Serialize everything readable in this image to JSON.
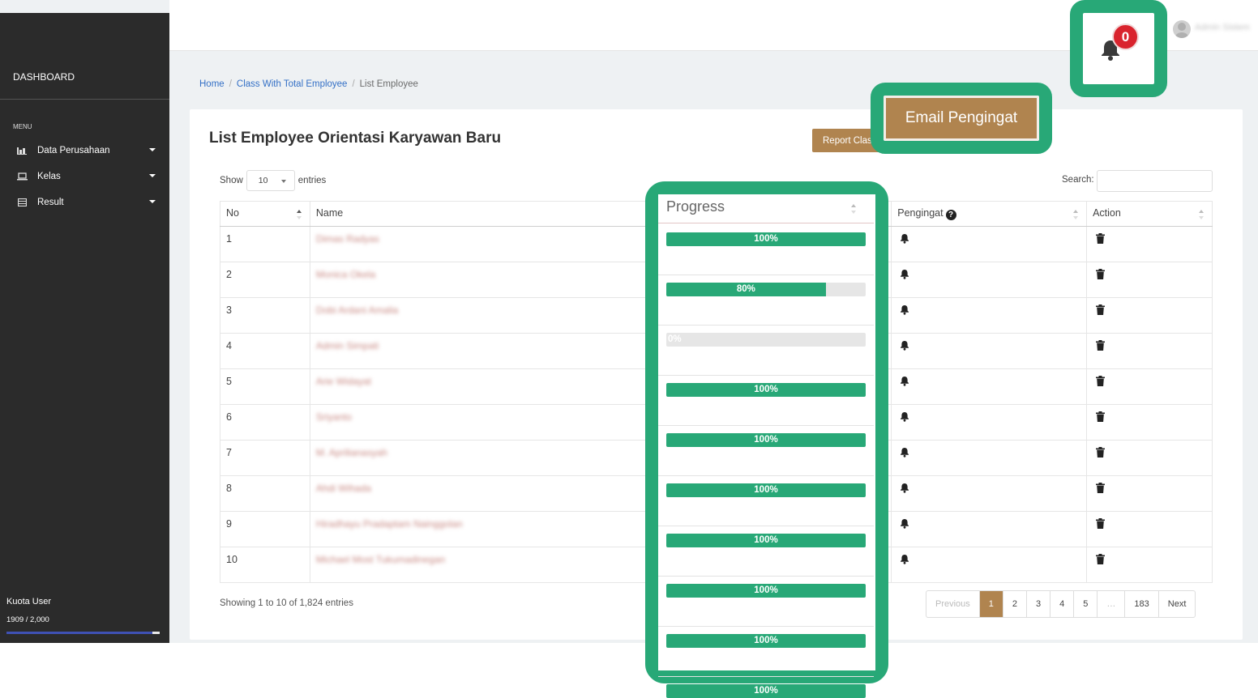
{
  "sidebar": {
    "brand": "DASHBOARD",
    "menu_label": "MENU",
    "items": [
      {
        "label": "Data Perusahaan",
        "icon": "bar-chart-icon"
      },
      {
        "label": "Kelas",
        "icon": "laptop-icon"
      },
      {
        "label": "Result",
        "icon": "table-icon"
      }
    ],
    "kuota": {
      "label": "Kuota User",
      "value": "1909 / 2,000",
      "fraction": 0.9545
    }
  },
  "topbar": {
    "notification_count": "0",
    "user_name": "Admin Sistem"
  },
  "breadcrumb": {
    "home": "Home",
    "class": "Class With Total Employee",
    "current": "List Employee"
  },
  "page": {
    "title": "List Employee Orientasi Karyawan Baru",
    "report_button": "Report Class",
    "email_button": "Email Pengingat",
    "show_label": "Show",
    "entries_value": "10",
    "entries_label": "entries",
    "search_label": "Search:",
    "search_value": ""
  },
  "table": {
    "headers": {
      "no": "No",
      "name": "Name",
      "progress": "Progress",
      "pengingat": "Pengingat",
      "action": "Action"
    },
    "rows": [
      {
        "no": "1",
        "name": "Dimas Radyas",
        "progress": 100,
        "progress_label": "100%"
      },
      {
        "no": "2",
        "name": "Monica Okela",
        "progress": 80,
        "progress_label": "80%"
      },
      {
        "no": "3",
        "name": "Dobi Ardani Amalia",
        "progress": 0,
        "progress_label": "0%"
      },
      {
        "no": "4",
        "name": "Admin Simpati",
        "progress": 100,
        "progress_label": "100%"
      },
      {
        "no": "5",
        "name": "Arie Widayat",
        "progress": 100,
        "progress_label": "100%"
      },
      {
        "no": "6",
        "name": "Sriyanto",
        "progress": 100,
        "progress_label": "100%"
      },
      {
        "no": "7",
        "name": "M. Aprilianasyah",
        "progress": 100,
        "progress_label": "100%"
      },
      {
        "no": "8",
        "name": "Ahdi Wihada",
        "progress": 100,
        "progress_label": "100%"
      },
      {
        "no": "9",
        "name": "Hiradhayu Pradaptam Nainggolan",
        "progress": 100,
        "progress_label": "100%"
      },
      {
        "no": "10",
        "name": "Michael Most Tukumadinegan",
        "progress": 100,
        "progress_label": "100%"
      }
    ]
  },
  "footer": {
    "showing": "Showing 1 to 10 of 1,824 entries",
    "pagination": [
      "Previous",
      "1",
      "2",
      "3",
      "4",
      "5",
      "…",
      "183",
      "Next"
    ],
    "active_page": "1"
  },
  "colors": {
    "accent_brown": "#b0844f",
    "progress_green": "#28a877",
    "sidebar_bg": "#2b2b2b",
    "badge_red": "#d9232d",
    "link_blue": "#3470c6"
  }
}
